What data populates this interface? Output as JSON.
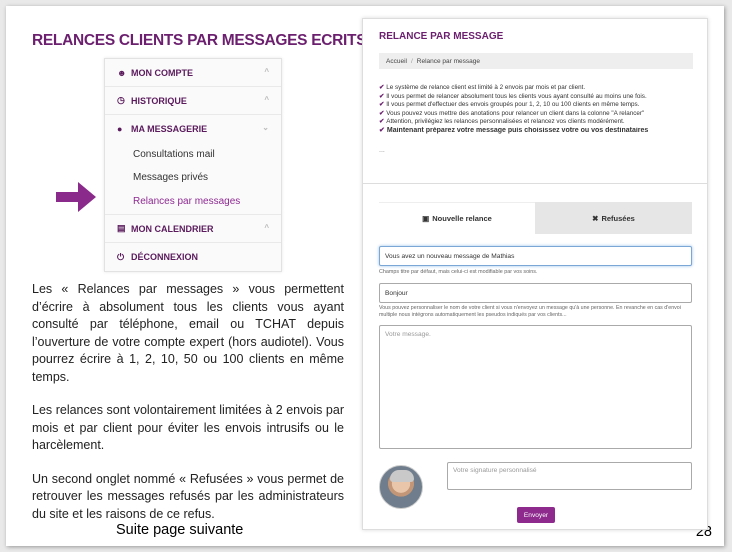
{
  "left": {
    "title": "RELANCES CLIENTS PAR MESSAGES ECRITS",
    "menu": {
      "mon_compte": "MON COMPTE",
      "historique": "HISTORIQUE",
      "ma_messagerie": "MA MESSAGERIE",
      "sub_items": [
        "Consultations mail",
        "Messages privés",
        "Relances par messages"
      ],
      "mon_calendrier": "MON CALENDRIER",
      "deconnexion": "DÉCONNEXION"
    },
    "paragraphs": [
      "Les « Relances par messages » vous permettent d’écrire à absolument tous les clients vous ayant consulté par téléphone, email ou TCHAT depuis l’ouverture de votre compte expert (hors audiotel). Vous pourrez écrire à 1, 2, 10, 50 ou 100 clients en même temps.",
      "Les relances sont volontairement limitées à 2 envois par mois et par client pour éviter les envois intrusifs ou le harcèlement.",
      "Un second onglet nommé « Refusées » vous permet de retrouver les messages refusés par les administrateurs du site et les raisons de ce refus."
    ],
    "footer": "Suite page suivante",
    "page_number": "28"
  },
  "screenshot": {
    "title": "RELANCE PAR MESSAGE",
    "breadcrumb": [
      "Accueil",
      "Relance par message"
    ],
    "bullets": [
      "Le système de relance client est limité à 2 envois par mois et par client.",
      "Il vous permet de relancer absolument tous les clients vous ayant consulté au moins une fois.",
      "Il vous permet d'effectuer des envois groupés pour 1, 2, 10 ou 100 clients en même temps.",
      "Vous pouvez vous mettre des anotations pour relancer un client dans la colonne \"A relancer\"",
      "Attention, privilégiez les relances personnalisées et relancez vos clients modérément."
    ],
    "bullet_strong": "Maintenant préparez votre message puis choisissez votre ou vos destinataires",
    "ellipsis": "...",
    "tabs": {
      "new": "Nouvelle relance",
      "refused": "Refusées"
    },
    "title_field_value": "Vous avez un nouveau message de Mathias",
    "title_help": "Champs titre par défaut, mais celui-ci est modifiable par vos soins.",
    "greeting_value": "Bonjour",
    "greeting_help": "Vous pouvez personnaliser le nom de votre client si vous n'envoyez un message qu'à une personne. En revanche en cas d'envoi multiple nous intégrons automatiquement les pseudos indiqués par vos clients...",
    "message_placeholder": "Votre message.",
    "signature_placeholder": "Votre signature personnalisé",
    "send_label": "Envoyer"
  },
  "colors": {
    "brand_purple": "#6b1f6e",
    "arrow_purple": "#8a2b8c",
    "button": "#8e2a8e"
  }
}
